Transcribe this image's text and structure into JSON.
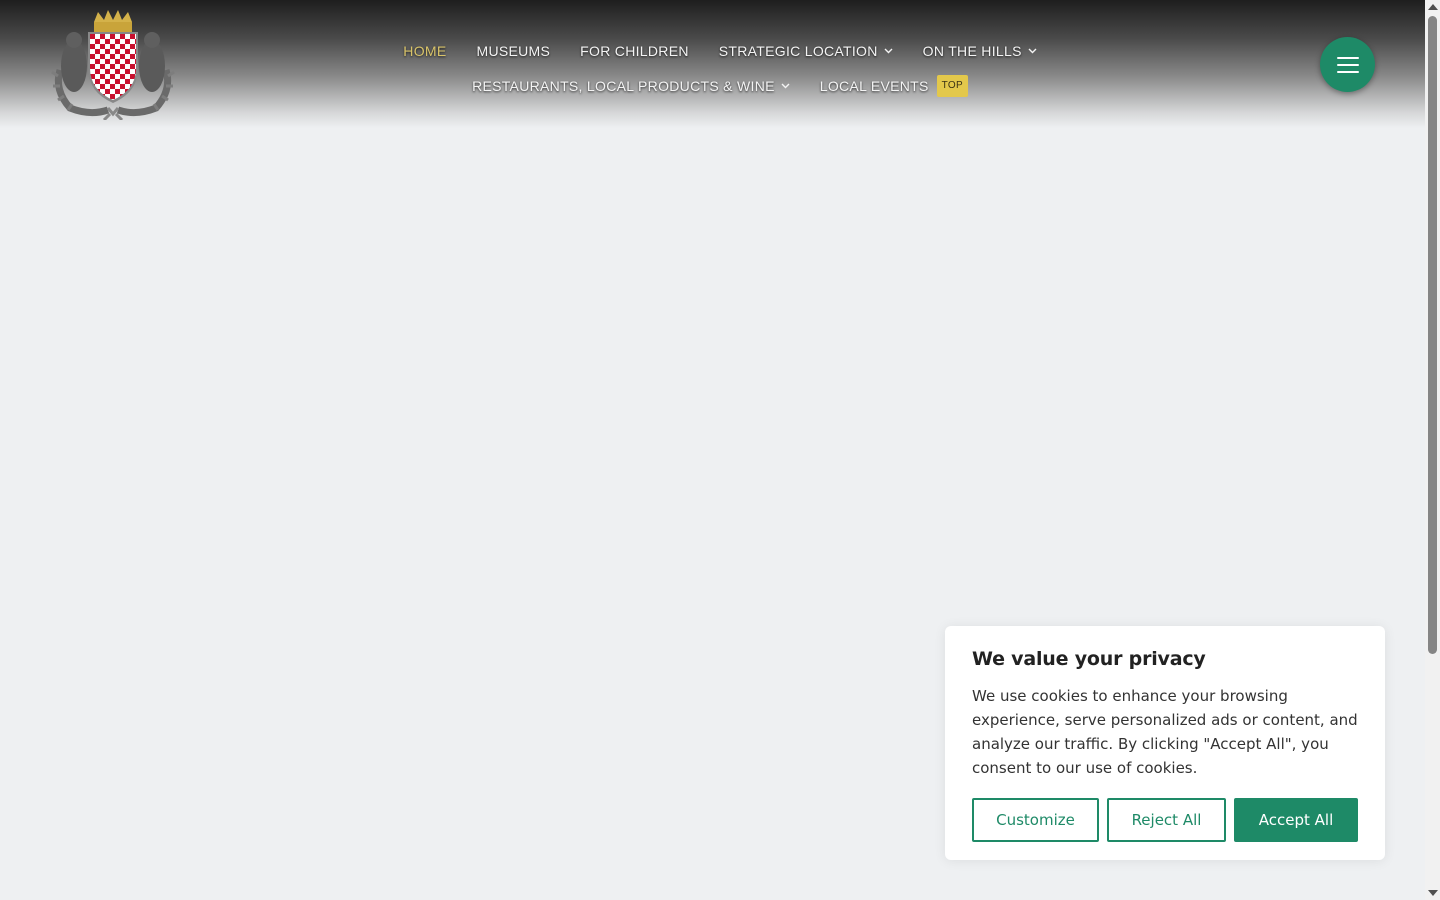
{
  "nav": {
    "items": [
      {
        "label": "HOME",
        "active": true,
        "has_dropdown": false
      },
      {
        "label": "MUSEUMS",
        "active": false,
        "has_dropdown": false
      },
      {
        "label": "FOR CHILDREN",
        "active": false,
        "has_dropdown": false
      },
      {
        "label": "STRATEGIC LOCATION",
        "active": false,
        "has_dropdown": true
      },
      {
        "label": "ON THE HILLS",
        "active": false,
        "has_dropdown": true
      },
      {
        "label": "RESTAURANTS, LOCAL PRODUCTS & WINE",
        "active": false,
        "has_dropdown": true
      },
      {
        "label": "LOCAL EVENTS",
        "active": false,
        "has_dropdown": false,
        "badge": "TOP"
      }
    ]
  },
  "menu_button": {
    "icon": "hamburger-icon"
  },
  "logo": {
    "icon": "coat-of-arms-logo"
  },
  "cookie_banner": {
    "title": "We value your privacy",
    "text": "We use cookies to enhance your browsing experience, serve personalized ads or content, and analyze our traffic. By clicking \"Accept All\", you consent to our use of cookies.",
    "customize_label": "Customize",
    "reject_label": "Reject All",
    "accept_label": "Accept All"
  },
  "colors": {
    "accent": "#1e8a67",
    "active_nav": "#d8c36a",
    "badge": "#e3c84b",
    "page_background": "#eef0f2"
  }
}
